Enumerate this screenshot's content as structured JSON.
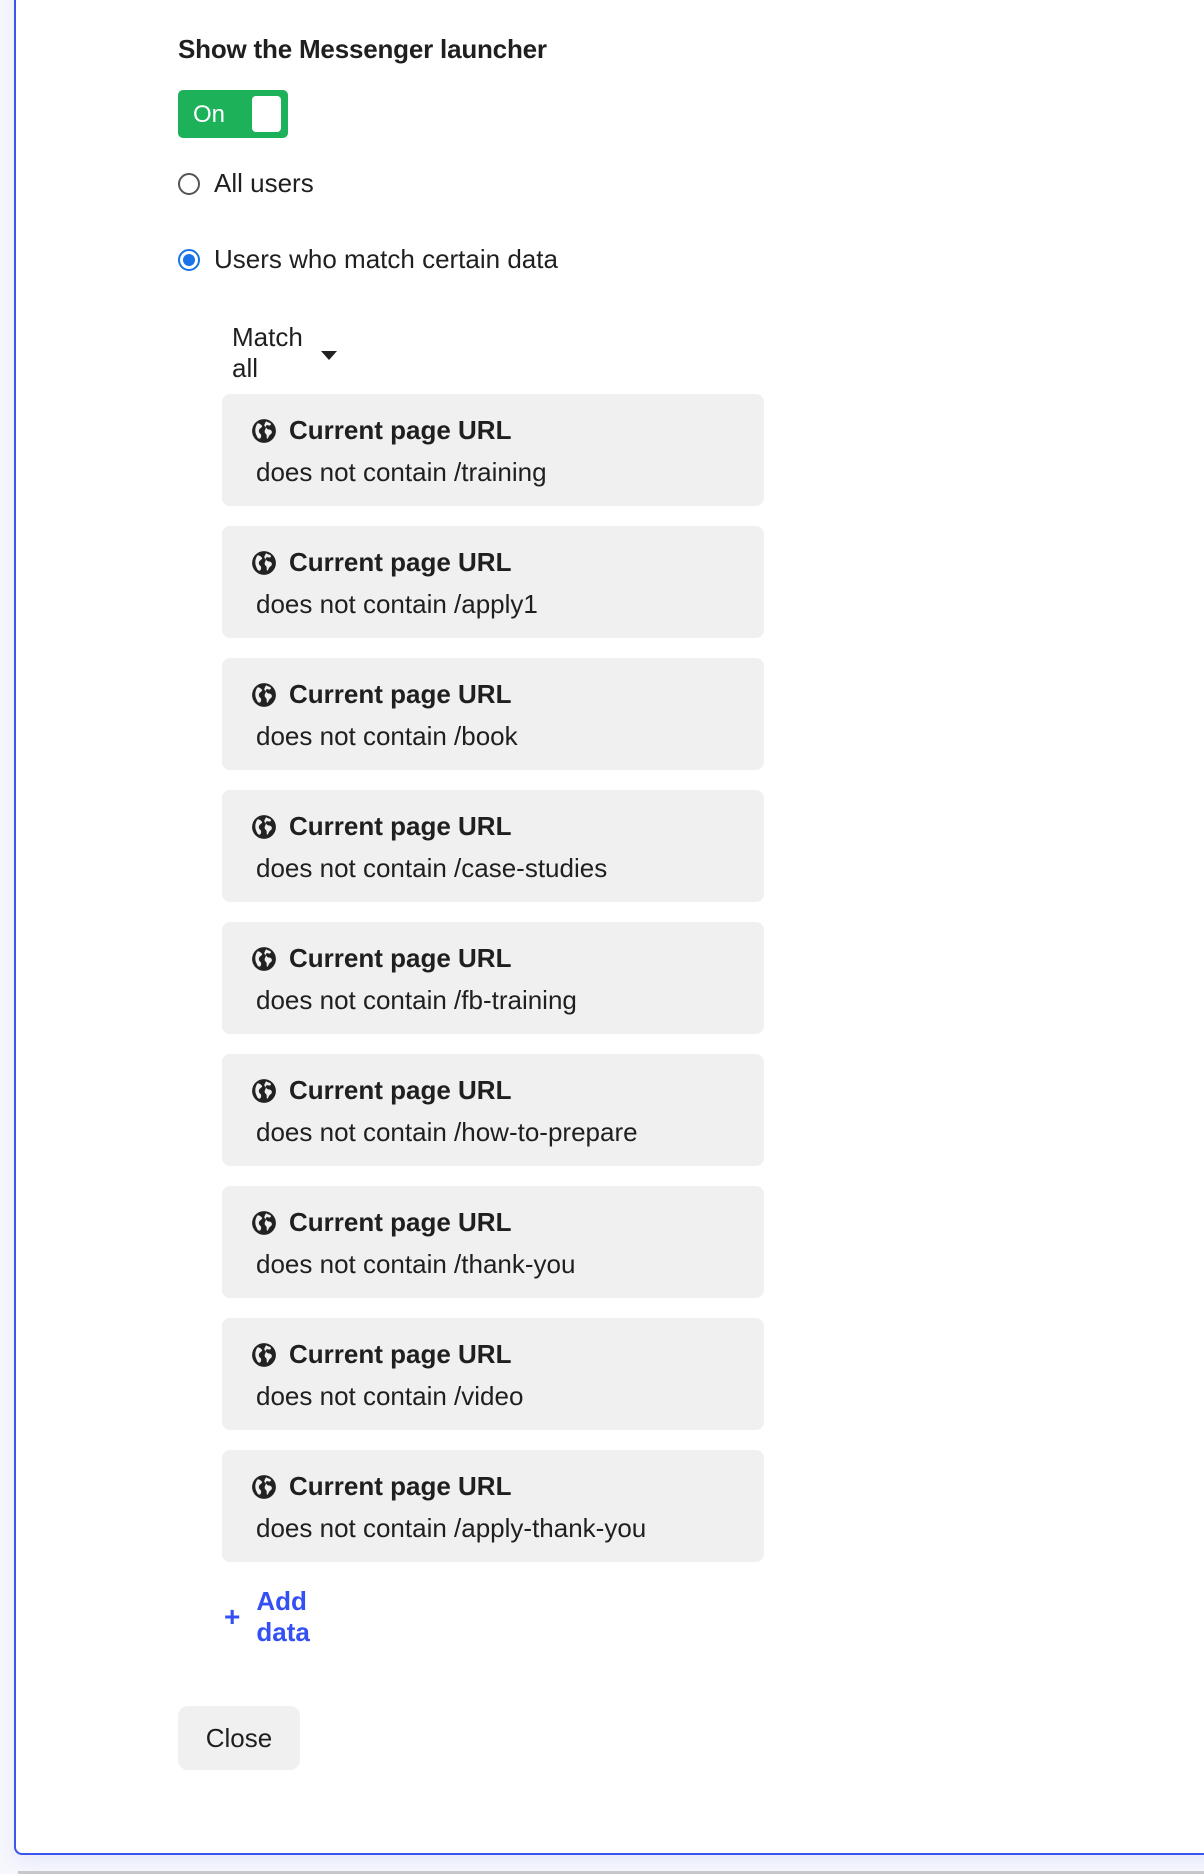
{
  "section": {
    "heading": "Show the Messenger launcher",
    "toggle": {
      "label": "On",
      "state": "on",
      "color": "#1db15a"
    },
    "audience_options": [
      {
        "label": "All users",
        "checked": false
      },
      {
        "label": "Users who match certain data",
        "checked": true
      }
    ],
    "match_mode": "Match all",
    "rules": [
      {
        "attribute": "Current page URL",
        "icon": "globe-icon",
        "condition": "does not contain /training"
      },
      {
        "attribute": "Current page URL",
        "icon": "globe-icon",
        "condition": "does not contain /apply1"
      },
      {
        "attribute": "Current page URL",
        "icon": "globe-icon",
        "condition": "does not contain /book"
      },
      {
        "attribute": "Current page URL",
        "icon": "globe-icon",
        "condition": "does not contain /case-studies"
      },
      {
        "attribute": "Current page URL",
        "icon": "globe-icon",
        "condition": "does not contain /fb-training"
      },
      {
        "attribute": "Current page URL",
        "icon": "globe-icon",
        "condition": "does not contain /how-to-prepare"
      },
      {
        "attribute": "Current page URL",
        "icon": "globe-icon",
        "condition": "does not contain /thank-you"
      },
      {
        "attribute": "Current page URL",
        "icon": "globe-icon",
        "condition": "does not contain /video"
      },
      {
        "attribute": "Current page URL",
        "icon": "globe-icon",
        "condition": "does not contain /apply-thank-you"
      }
    ],
    "add_data_label": "Add data",
    "add_data_icon": "+",
    "accent_color": "#3450f2",
    "close_label": "Close"
  }
}
